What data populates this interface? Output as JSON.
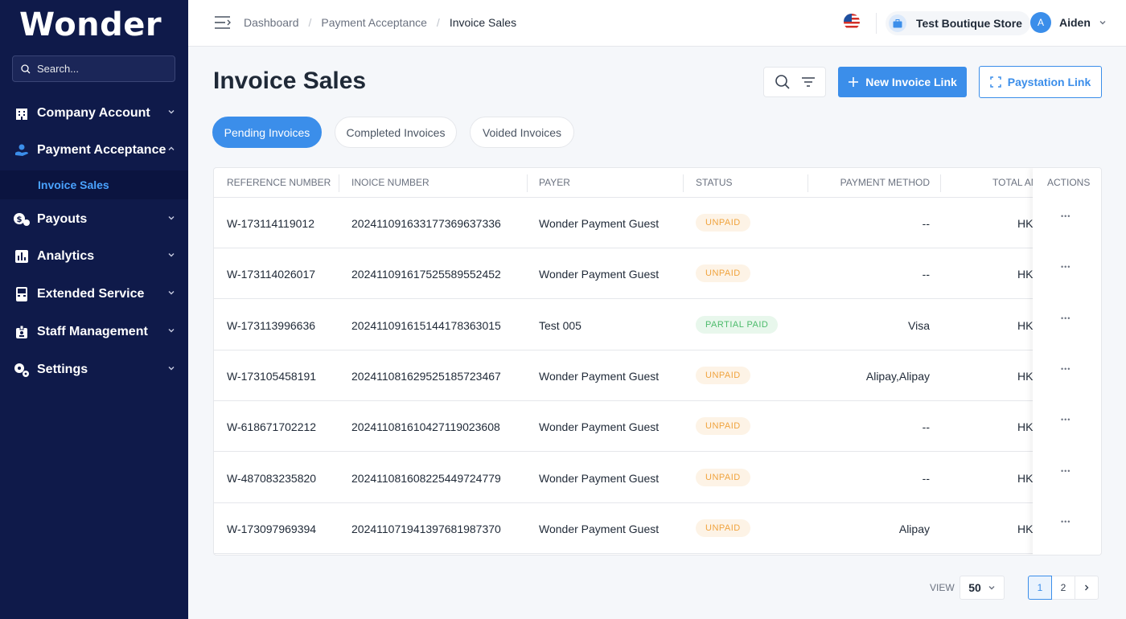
{
  "brand": {
    "logo": "Wonder"
  },
  "search": {
    "placeholder": "Search..."
  },
  "sidebar": {
    "items": [
      {
        "label": "Company Account",
        "icon": "building-icon"
      },
      {
        "label": "Payment Acceptance",
        "icon": "hand-user-icon",
        "expanded": true
      },
      {
        "label": "Payouts",
        "icon": "coins-icon"
      },
      {
        "label": "Analytics",
        "icon": "bar-chart-icon"
      },
      {
        "label": "Extended Service",
        "icon": "terminal-icon"
      },
      {
        "label": "Staff Management",
        "icon": "badge-icon"
      },
      {
        "label": "Settings",
        "icon": "gears-icon"
      }
    ],
    "sub_items": [
      {
        "label": "Invoice Sales",
        "active": true
      }
    ]
  },
  "breadcrumb": [
    "Dashboard",
    "Payment Acceptance",
    "Invoice Sales"
  ],
  "topbar": {
    "store": "Test Boutique Store",
    "user_initial": "A",
    "user_name": "Aiden"
  },
  "page": {
    "title": "Invoice Sales",
    "new_invoice_label": "New Invoice Link",
    "paystation_label": "Paystation Link"
  },
  "tabs": [
    {
      "label": "Pending Invoices",
      "active": true
    },
    {
      "label": "Completed Invoices",
      "active": false
    },
    {
      "label": "Voided Invoices",
      "active": false
    }
  ],
  "table": {
    "headers": {
      "reference": "REFERENCE NUMBER",
      "invoice": "INOICE NUMBER",
      "payer": "PAYER",
      "status": "STATUS",
      "method": "PAYMENT METHOD",
      "total": "TOTAL AMOUNT",
      "actions": "ACTIONS"
    },
    "rows": [
      {
        "reference": "W-173114119012",
        "invoice": "20241109163317736963733​6",
        "payer": "Wonder Payment Guest",
        "status": "UNPAID",
        "method": "--",
        "total": "HK"
      },
      {
        "reference": "W-173114026017",
        "invoice": "202411091617525589552452",
        "payer": "Wonder Payment Guest",
        "status": "UNPAID",
        "method": "--",
        "total": "HK"
      },
      {
        "reference": "W-173113996636",
        "invoice": "202411091615144178363015",
        "payer": "Test 005",
        "status": "PARTIAL PAID",
        "method": "Visa",
        "total": "HK"
      },
      {
        "reference": "W-173105458191",
        "invoice": "202411081629525185723467",
        "payer": "Wonder Payment Guest",
        "status": "UNPAID",
        "method": "Alipay,Alipay",
        "total": "HK"
      },
      {
        "reference": "W-618671702212",
        "invoice": "202411081610427119023608",
        "payer": "Wonder Payment Guest",
        "status": "UNPAID",
        "method": "--",
        "total": "HK"
      },
      {
        "reference": "W-487083235820",
        "invoice": "202411081608225449724779",
        "payer": "Wonder Payment Guest",
        "status": "UNPAID",
        "method": "--",
        "total": "HK"
      },
      {
        "reference": "W-173097969394",
        "invoice": "202411071941397681987370",
        "payer": "Wonder Payment Guest",
        "status": "UNPAID",
        "method": "Alipay",
        "total": "HK"
      }
    ]
  },
  "pagination": {
    "view_label": "VIEW",
    "page_size": "50",
    "pages": [
      "1",
      "2"
    ],
    "current": "1"
  },
  "colors": {
    "sidebar": "#0f1a4a",
    "accent": "#3b8eea",
    "unpaid": "#f0a33d",
    "partial": "#4cbb6b"
  }
}
